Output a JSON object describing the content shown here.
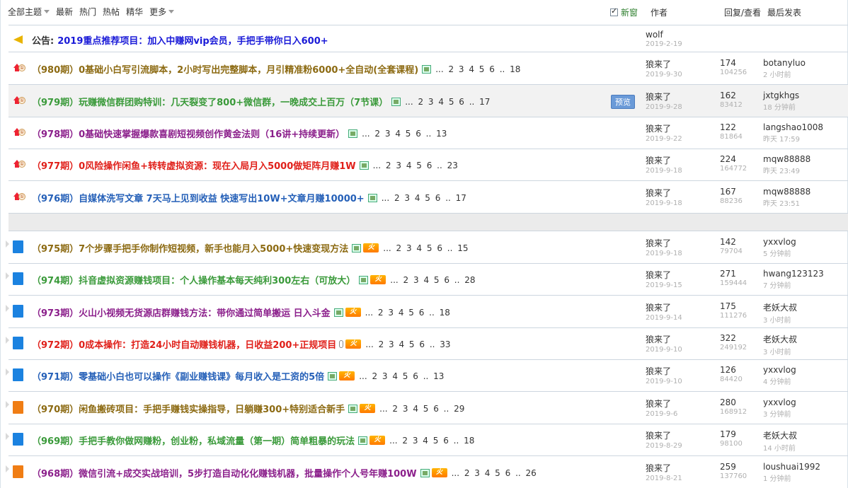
{
  "header": {
    "filter_all": "全部主题",
    "filter_latest": "最新",
    "filter_hot": "热门",
    "filter_hotpost": "热帖",
    "filter_essence": "精华",
    "filter_more": "更多",
    "new_window_label": "新窗",
    "col_author": "作者",
    "col_reply_view": "回复/查看",
    "col_last_post": "最后发表"
  },
  "announcement": {
    "prefix": "公告:",
    "title": "2019重点推荐项目：加入中赚网vip会员，手把手带你日入600+",
    "author": "wolf",
    "date": "2019-2-19"
  },
  "pinned": [
    {
      "title": "（980期）0基础小白写引流脚本，2小时写出完整脚本，月引精准粉6000+全自动(全套课程)",
      "color": "#8c6a12",
      "pages": "... 2 3 4 5 6 .. 18",
      "author": "狼来了",
      "date": "2019-9-30",
      "replies": "174",
      "views": "104256",
      "last_user": "botanyluo",
      "last_time": "2 小时前"
    },
    {
      "title": "（979期）玩赚微信群团购特训：几天裂变了800+微信群，一晚成交上百万（7节课）",
      "color": "#3a9a3a",
      "pages": "... 2 3 4 5 6 .. 17",
      "author": "狼来了",
      "date": "2019-9-28",
      "replies": "162",
      "views": "83412",
      "last_user": "jxtgkhgs",
      "last_time": "18 分钟前",
      "preview": "预览"
    },
    {
      "title": "（978期）0基础快速掌握爆款喜剧短视频创作黄金法则（16讲+持续更新）",
      "color": "#8b1f8b",
      "pages": "... 2 3 4 5 6 .. 13",
      "author": "狼来了",
      "date": "2019-9-22",
      "replies": "122",
      "views": "81864",
      "last_user": "langshao1008",
      "last_time": "昨天 17:59"
    },
    {
      "title": "（977期）0风险操作闲鱼+转转虚拟资源：现在入局月入5000做矩阵月赚1W",
      "color": "#e0201a",
      "pages": "... 2 3 4 5 6 .. 23",
      "author": "狼来了",
      "date": "2019-9-18",
      "replies": "224",
      "views": "164772",
      "last_user": "mqw88888",
      "last_time": "昨天 23:49"
    },
    {
      "title": "（976期）自媒体洗写文章 7天马上见到收益 快速写出10W+文章月赚10000+",
      "color": "#2560b8",
      "pages": "... 2 3 4 5 6 .. 17",
      "author": "狼来了",
      "date": "2019-9-18",
      "replies": "167",
      "views": "88236",
      "last_user": "mqw88888",
      "last_time": "昨天 23:51"
    }
  ],
  "threads": [
    {
      "title": "（975期）7个步骤手把手你制作短视频，新手也能月入5000+快速变现方法",
      "color": "#8c6a12",
      "icon": "blue",
      "pages": "... 2 3 4 5 6 .. 15",
      "author": "狼来了",
      "date": "2019-9-18",
      "replies": "142",
      "views": "79704",
      "last_user": "yxxvlog",
      "last_time": "5 分钟前"
    },
    {
      "title": "（974期）抖音虚拟资源赚钱项目：个人操作基本每天纯利300左右（可放大）",
      "color": "#3a9a3a",
      "icon": "blue",
      "pages": "... 2 3 4 5 6 .. 28",
      "author": "狼来了",
      "date": "2019-9-15",
      "replies": "271",
      "views": "159444",
      "last_user": "hwang123123",
      "last_time": "7 分钟前"
    },
    {
      "title": "（973期）火山小视频无货源店群赚钱方法：带你通过简单搬运 日入斗金",
      "color": "#8b1f8b",
      "icon": "blue",
      "pages": "... 2 3 4 5 6 .. 18",
      "author": "狼来了",
      "date": "2019-9-14",
      "replies": "175",
      "views": "111276",
      "last_user": "老妖大叔",
      "last_time": "3 小时前"
    },
    {
      "title": "（972期）0成本操作：打造24小时自动赚钱机器，日收益200+正规项目",
      "color": "#e0201a",
      "icon": "blue",
      "pages": "... 2 3 4 5 6 .. 33",
      "author": "狼来了",
      "date": "2019-9-10",
      "replies": "322",
      "views": "249192",
      "last_user": "老妖大叔",
      "last_time": "3 小时前",
      "clip": true
    },
    {
      "title": "（971期）零基础小白也可以操作《副业赚钱课》每月收入是工资的5倍",
      "color": "#2560b8",
      "icon": "blue",
      "pages": "... 2 3 4 5 6 .. 13",
      "author": "狼来了",
      "date": "2019-9-10",
      "replies": "126",
      "views": "84420",
      "last_user": "yxxvlog",
      "last_time": "4 分钟前"
    },
    {
      "title": "（970期）闲鱼搬砖项目：手把手赚钱实操指导，日躺赚300+特别适合新手",
      "color": "#8c6a12",
      "icon": "orange",
      "pages": "... 2 3 4 5 6 .. 29",
      "author": "狼来了",
      "date": "2019-9-6",
      "replies": "280",
      "views": "168912",
      "last_user": "yxxvlog",
      "last_time": "3 分钟前"
    },
    {
      "title": "（969期）手把手教你做网赚粉，创业粉，私域流量（第一期）简单粗暴的玩法",
      "color": "#3a9a3a",
      "icon": "blue",
      "pages": "... 2 3 4 5 6 .. 18",
      "author": "狼来了",
      "date": "2019-8-29",
      "replies": "179",
      "views": "98100",
      "last_user": "老妖大叔",
      "last_time": "14 小时前"
    },
    {
      "title": "（968期）微信引流+成交实战培训，5步打造自动化化赚钱机器，批量操作个人号年赚100W",
      "color": "#8b1f8b",
      "icon": "orange",
      "pages": "... 2 3 4 5 6 .. 26",
      "author": "狼来了",
      "date": "2019-8-21",
      "replies": "259",
      "views": "137760",
      "last_user": "loushuai1992",
      "last_time": "1 分钟前"
    }
  ],
  "hot_badge": "火"
}
